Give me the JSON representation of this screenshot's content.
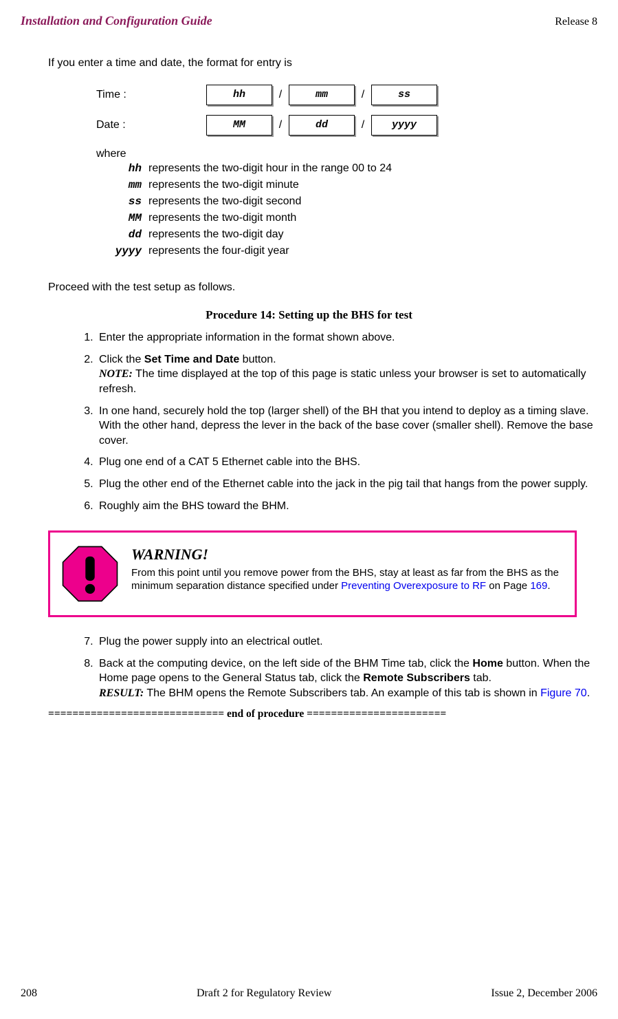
{
  "header": {
    "title": "Installation and Configuration Guide",
    "release": "Release 8"
  },
  "intro": "If you enter a time and date, the format for entry is",
  "format": {
    "time_label": "Time :",
    "date_label": "Date :",
    "sep": "/",
    "time_fields": [
      "hh",
      "mm",
      "ss"
    ],
    "date_fields": [
      "MM",
      "dd",
      "yyyy"
    ]
  },
  "where_label": "where",
  "defs": [
    {
      "term": "hh",
      "desc": "represents the two-digit hour in the range 00 to 24"
    },
    {
      "term": "mm",
      "desc": "represents the two-digit minute"
    },
    {
      "term": "ss",
      "desc": "represents the two-digit second"
    },
    {
      "term": "MM",
      "desc": "represents the two-digit month"
    },
    {
      "term": "dd",
      "desc": "represents the two-digit day"
    },
    {
      "term": "yyyy",
      "desc": "represents the four-digit year"
    }
  ],
  "proceed": "Proceed with the test setup as follows.",
  "proc_title": "Procedure 14: Setting up the BHS for test",
  "steps": {
    "s1": "Enter the appropriate information in the format shown above.",
    "s2a": "Click the ",
    "s2b": "Set Time and Date",
    "s2c": " button.",
    "s2note_lbl": "NOTE:",
    "s2note": " The time displayed at the top of this page is static unless your browser is set to automatically refresh.",
    "s3": "In one hand, securely hold the top (larger shell) of the BH that you intend to deploy as a timing slave. With the other hand, depress the lever in the back of the base cover (smaller shell). Remove the base cover.",
    "s4": "Plug one end of a CAT 5 Ethernet cable into the BHS.",
    "s5": "Plug the other end of the Ethernet cable into the jack in the pig tail that hangs from the power supply.",
    "s6": "Roughly aim the BHS toward the BHM.",
    "s7": "Plug the power supply into an electrical outlet.",
    "s8a": "Back at the computing device, on the left side of the BHM Time tab, click the ",
    "s8b": "Home",
    "s8c": " button. When the Home page opens to the General Status tab, click the ",
    "s8d": "Remote Subscribers",
    "s8e": " tab.",
    "s8res_lbl": "RESULT:",
    "s8res": " The BHM opens the Remote Subscribers tab. An example of this tab is shown in ",
    "s8fig": "Figure 70",
    "s8dot": "."
  },
  "warning": {
    "title": "WARNING!",
    "text_a": "From this point until you remove power from the BHS, stay at least as far from the BHS as the minimum separation distance specified under ",
    "link": "Preventing Overexposure to RF",
    "text_b": "  on Page ",
    "page": "169",
    "dot": "."
  },
  "eop": "============================= end of procedure =======================",
  "footer": {
    "page": "208",
    "center": "Draft 2 for Regulatory Review",
    "right": "Issue 2, December 2006"
  }
}
